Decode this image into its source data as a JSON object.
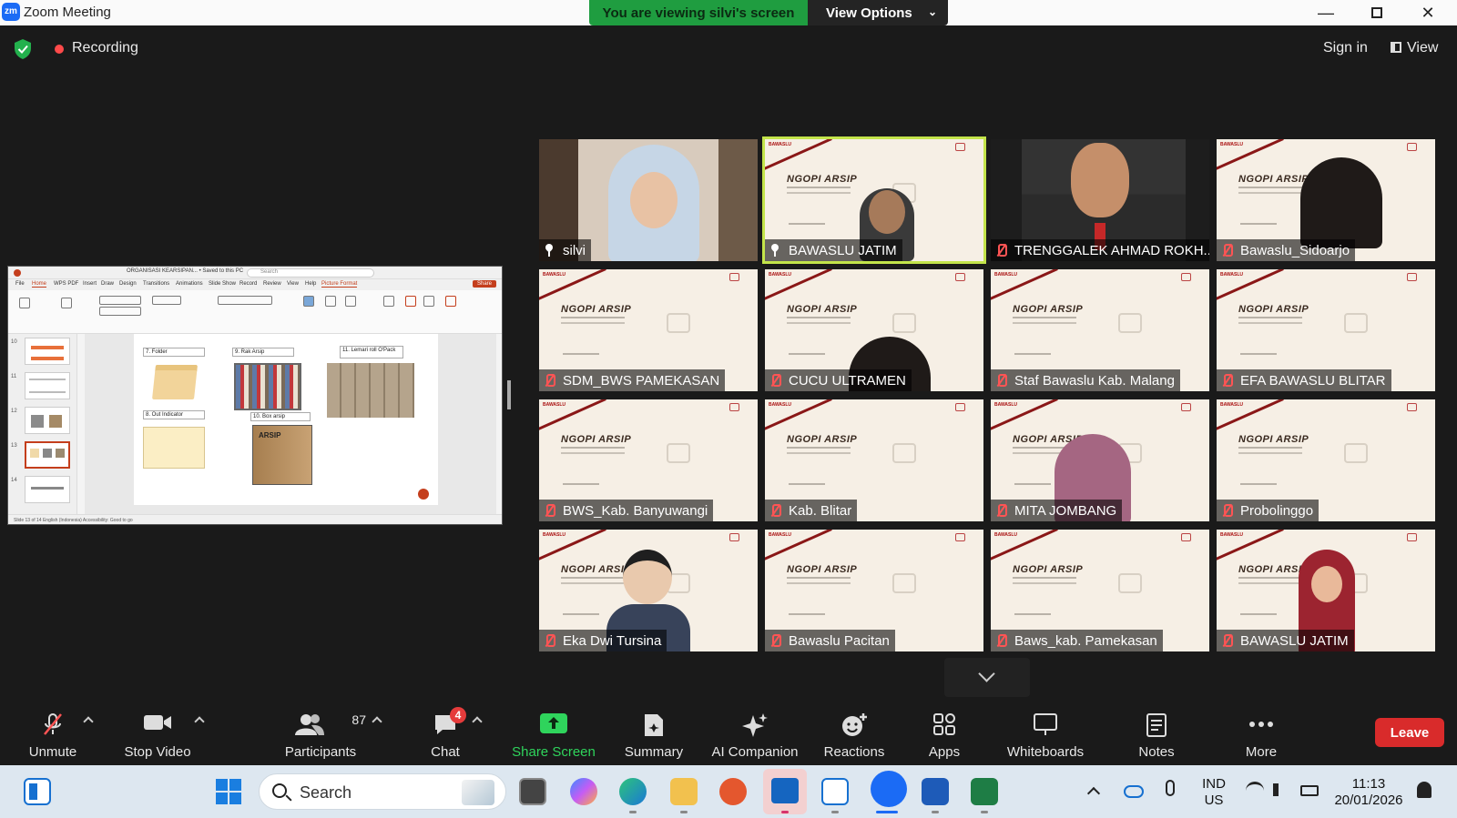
{
  "window": {
    "app_title": "Zoom Meeting",
    "logo_text": "zm",
    "viewing_banner": "You are viewing silvi's screen",
    "view_options": "View Options"
  },
  "meeting_bar": {
    "recording": "Recording",
    "sign_in": "Sign in",
    "view": "View"
  },
  "shared_screen": {
    "doc_title": "ORGANISASI KEARSIPAN... • Saved to this PC",
    "search_placeholder": "Search",
    "menu": [
      "File",
      "Home",
      "WPS PDF",
      "Insert",
      "Draw",
      "Design",
      "Transitions",
      "Animations",
      "Slide Show",
      "Record",
      "Review",
      "View",
      "Help",
      "Picture Format"
    ],
    "share_label": "Share",
    "thumb_numbers": [
      "10",
      "11",
      "12",
      "13",
      "14"
    ],
    "slide_labels": [
      "7. Folder",
      "9. Rak Arsip",
      "11. Lemari roll O'Pack",
      "8. Out Indicator",
      "10. Box arsip"
    ],
    "box_text": "ARSIP",
    "status_text": "Slide 13 of 14   English (Indonesia)   Accessibility: Good to go"
  },
  "participants": [
    {
      "name": "silvi",
      "mic": "pinned",
      "kind": "camera-woman-hijab"
    },
    {
      "name": "BAWASLU JATIM",
      "mic": "pinned",
      "kind": "banner-person",
      "active": true
    },
    {
      "name": "TRENGGALEK AHMAD ROKH...",
      "mic": "muted",
      "kind": "photo-man"
    },
    {
      "name": "Bawaslu_Sidoarjo",
      "mic": "muted",
      "kind": "banner-head"
    },
    {
      "name": "SDM_BWS PAMEKASAN",
      "mic": "muted",
      "kind": "banner"
    },
    {
      "name": "CUCU ULTRAMEN",
      "mic": "muted",
      "kind": "banner-head"
    },
    {
      "name": "Staf Bawaslu Kab. Malang",
      "mic": "muted",
      "kind": "banner"
    },
    {
      "name": "EFA BAWASLU BLITAR",
      "mic": "muted",
      "kind": "banner"
    },
    {
      "name": "BWS_Kab. Banyuwangi",
      "mic": "muted",
      "kind": "banner"
    },
    {
      "name": "Kab. Blitar",
      "mic": "muted",
      "kind": "banner"
    },
    {
      "name": "MITA JOMBANG",
      "mic": "muted",
      "kind": "banner-hijab"
    },
    {
      "name": "Probolinggo",
      "mic": "muted",
      "kind": "banner"
    },
    {
      "name": "Eka Dwi Tursina",
      "mic": "muted",
      "kind": "banner-avatar-man"
    },
    {
      "name": "Bawaslu Pacitan",
      "mic": "muted",
      "kind": "banner"
    },
    {
      "name": "Baws_kab. Pamekasan",
      "mic": "muted",
      "kind": "banner"
    },
    {
      "name": "BAWASLU JATIM",
      "mic": "muted",
      "kind": "banner-avatar-woman"
    }
  ],
  "banner": {
    "logo": "BAWASLU",
    "title": "NGOPI ARSIP"
  },
  "toolbar": {
    "unmute": "Unmute",
    "stop_video": "Stop Video",
    "participants": "Participants",
    "participants_count": "87",
    "chat": "Chat",
    "chat_badge": "4",
    "share_screen": "Share Screen",
    "summary": "Summary",
    "ai_companion": "AI Companion",
    "reactions": "Reactions",
    "apps": "Apps",
    "whiteboards": "Whiteboards",
    "notes": "Notes",
    "more": "More",
    "leave": "Leave"
  },
  "taskbar": {
    "search": "Search",
    "lang_top": "IND",
    "lang_bottom": "US",
    "time": "11:13",
    "date": "20/01/2026"
  },
  "colors": {
    "share_green": "#2fd45c",
    "leave_red": "#d92b2b",
    "banner_bg": "#f6efe5",
    "active_outline": "#c3e44a"
  }
}
